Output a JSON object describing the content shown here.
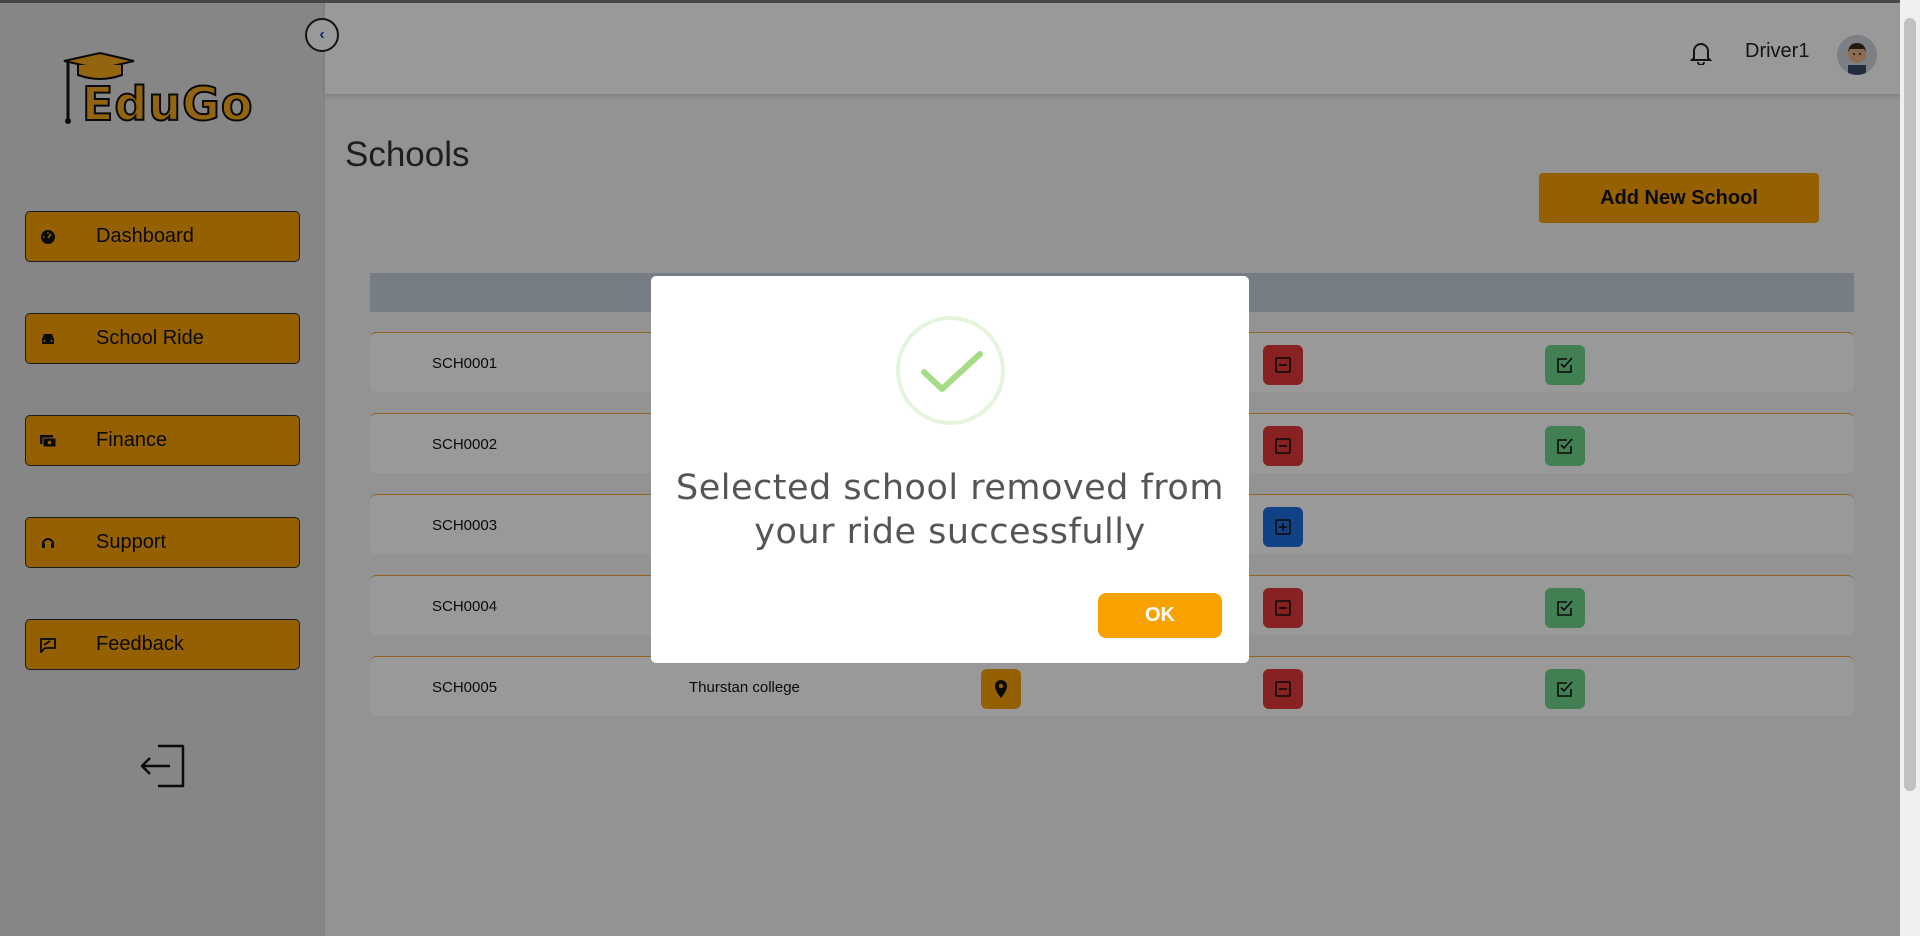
{
  "app": {
    "logo_text": "EduGo"
  },
  "sidebar": {
    "items": [
      {
        "label": "Dashboard",
        "icon": "speedometer-icon"
      },
      {
        "label": "School Ride",
        "icon": "car-icon"
      },
      {
        "label": "Finance",
        "icon": "cash-icon"
      },
      {
        "label": "Support",
        "icon": "headset-icon"
      },
      {
        "label": "Feedback",
        "icon": "chat-edit-icon"
      }
    ],
    "logout_icon": "logout-icon"
  },
  "header": {
    "username": "Driver1"
  },
  "main": {
    "title": "Schools",
    "add_button": "Add New School",
    "rows": [
      {
        "id": "SCH0001",
        "name": "",
        "action": "remove",
        "selected": true
      },
      {
        "id": "SCH0002",
        "name": "",
        "action": "remove",
        "selected": true
      },
      {
        "id": "SCH0003",
        "name": "",
        "action": "add",
        "selected": false
      },
      {
        "id": "SCH0004",
        "name": "",
        "action": "remove",
        "selected": true
      },
      {
        "id": "SCH0005",
        "name": "Thurstan college",
        "action": "remove",
        "selected": true
      }
    ]
  },
  "modal": {
    "message": "Selected school removed from your ride successfully",
    "ok_label": "OK"
  },
  "colors": {
    "accent": "#f9a100",
    "remove": "#e33a3a",
    "add": "#1f6fe0",
    "selected": "#6fd68a",
    "success_check": "#a5dc86"
  }
}
